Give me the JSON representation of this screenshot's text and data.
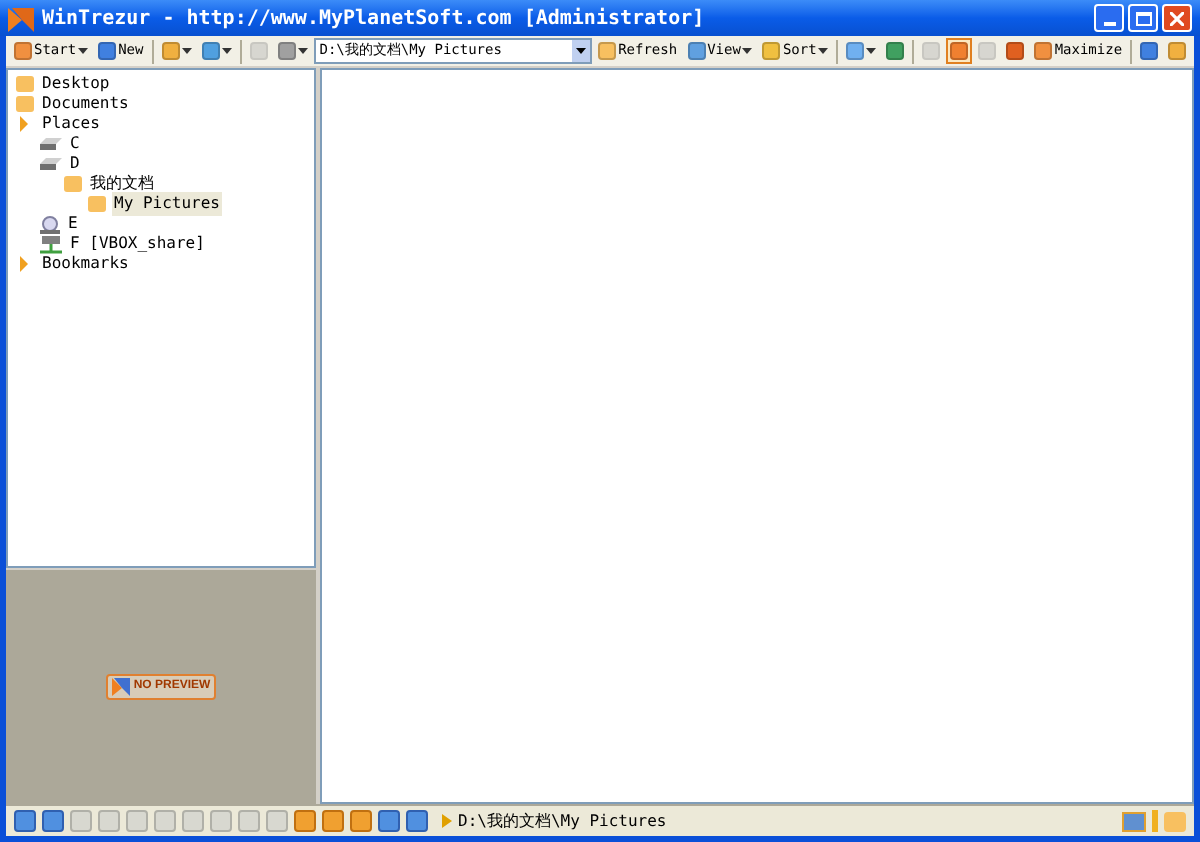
{
  "window": {
    "title": "WinTrezur - http://www.MyPlanetSoft.com [Administrator]"
  },
  "toolbar": [
    {
      "kind": "button",
      "label": "Start",
      "caret": true,
      "disabled": false,
      "pressed": false
    },
    {
      "kind": "button",
      "label": "New",
      "caret": false,
      "disabled": false,
      "pressed": false
    },
    {
      "kind": "separator"
    },
    {
      "kind": "button",
      "caret": true,
      "disabled": false,
      "pressed": false
    },
    {
      "kind": "button",
      "caret": true,
      "disabled": false,
      "pressed": false
    },
    {
      "kind": "separator"
    },
    {
      "kind": "button",
      "caret": false,
      "disabled": true,
      "pressed": false
    },
    {
      "kind": "button",
      "caret": true,
      "disabled": false,
      "pressed": false
    },
    {
      "kind": "address",
      "value": "D:\\我的文档\\My Pictures"
    },
    {
      "kind": "button",
      "label": "Refresh",
      "caret": false,
      "disabled": false,
      "pressed": false
    },
    {
      "kind": "button",
      "label": "View",
      "caret": true,
      "disabled": false,
      "pressed": false
    },
    {
      "kind": "button",
      "label": "Sort",
      "caret": true,
      "disabled": false,
      "pressed": false
    },
    {
      "kind": "separator"
    },
    {
      "kind": "button",
      "caret": true,
      "disabled": false,
      "pressed": false
    },
    {
      "kind": "button",
      "caret": false,
      "disabled": false,
      "pressed": false
    },
    {
      "kind": "separator"
    },
    {
      "kind": "button",
      "caret": false,
      "disabled": true,
      "pressed": false
    },
    {
      "kind": "button",
      "caret": false,
      "disabled": false,
      "pressed": true
    },
    {
      "kind": "button",
      "caret": false,
      "disabled": true,
      "pressed": false
    },
    {
      "kind": "button",
      "caret": false,
      "disabled": false,
      "pressed": false
    },
    {
      "kind": "button",
      "label": "Maximize",
      "caret": false,
      "disabled": false,
      "pressed": false
    },
    {
      "kind": "separator"
    },
    {
      "kind": "button",
      "caret": false,
      "disabled": false,
      "pressed": false
    },
    {
      "kind": "button",
      "caret": false,
      "disabled": false,
      "pressed": false
    }
  ],
  "tree": [
    {
      "kind": "folder",
      "label": "Desktop",
      "selected": false
    },
    {
      "kind": "folder",
      "label": "Documents",
      "selected": false
    },
    {
      "kind": "group",
      "label": "Places",
      "selected": false,
      "children": [
        {
          "kind": "drive",
          "label": "C",
          "selected": false
        },
        {
          "kind": "drive",
          "label": "D",
          "selected": false,
          "children": [
            {
              "kind": "folder",
              "label": "我的文档",
              "selected": false,
              "children": [
                {
                  "kind": "folder",
                  "label": "My Pictures",
                  "selected": true
                }
              ]
            }
          ]
        },
        {
          "kind": "disc",
          "label": "E",
          "selected": false
        },
        {
          "kind": "network",
          "label": "F [VBOX_share]",
          "selected": false
        }
      ]
    },
    {
      "kind": "group",
      "label": "Bookmarks",
      "selected": false
    }
  ],
  "preview": {
    "label": "NO PREVIEW"
  },
  "status_bar": {
    "buttons": [
      {
        "disabled": false
      },
      {
        "disabled": false
      },
      {
        "disabled": true
      },
      {
        "disabled": true
      },
      {
        "disabled": true
      },
      {
        "disabled": true
      },
      {
        "disabled": true
      },
      {
        "disabled": true
      },
      {
        "disabled": true
      },
      {
        "disabled": true
      },
      {
        "disabled": false
      },
      {
        "disabled": false
      },
      {
        "disabled": false
      },
      {
        "disabled": false
      },
      {
        "disabled": false
      }
    ],
    "path": "D:\\我的文档\\My Pictures"
  }
}
